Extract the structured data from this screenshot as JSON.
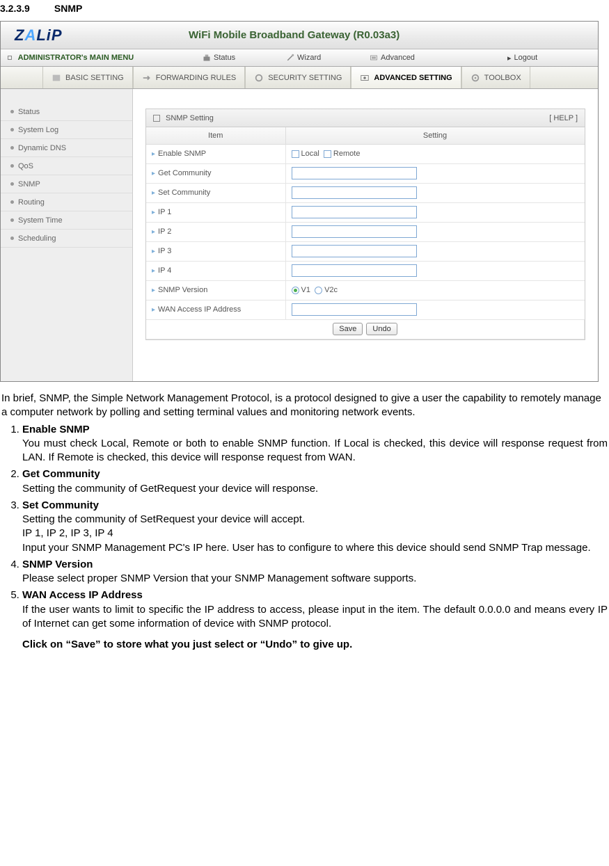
{
  "doc": {
    "section_number": "3.2.3.9",
    "section_title": "SNMP",
    "intro": "In brief, SNMP, the Simple Network Management Protocol, is a protocol designed to give a user the capability to remotely manage a computer network by polling and setting terminal values and monitoring network events.",
    "items": [
      {
        "title": "Enable SNMP",
        "paras": [
          "You must check Local, Remote or both to enable SNMP function. If Local is checked, this device will response request from LAN. If Remote is checked, this device will response request from WAN."
        ]
      },
      {
        "title": "Get Community",
        "paras": [
          "Setting the community of GetRequest your device will response."
        ]
      },
      {
        "title": "Set Community",
        "paras": [
          "Setting the community of SetRequest your device will accept.",
          "IP 1, IP 2, IP 3, IP 4",
          "Input your SNMP Management PC's IP here. User has to configure to where this device should send SNMP Trap message."
        ]
      },
      {
        "title": "SNMP Version",
        "paras": [
          "Please select proper SNMP Version that your SNMP Management software supports."
        ]
      },
      {
        "title": "WAN Access IP Address",
        "paras": [
          "If the user wants to limit to specific the IP address to access, please input in the item. The default 0.0.0.0 and means every IP of Internet can get some information of device with SNMP protocol."
        ]
      }
    ],
    "final": "Click on “Save” to store what you just select or “Undo” to give up."
  },
  "router": {
    "brand": "ZALiP",
    "title": "WiFi Mobile Broadband Gateway (R0.03a3)",
    "topnav": {
      "main": "ADMINISTRATOR's MAIN MENU",
      "status": "Status",
      "wizard": "Wizard",
      "advanced": "Advanced",
      "logout": "Logout"
    },
    "tabs": {
      "basic": "BASIC SETTING",
      "forwarding": "FORWARDING RULES",
      "security": "SECURITY SETTING",
      "advanced": "ADVANCED SETTING",
      "toolbox": "TOOLBOX"
    },
    "sidebar": [
      "Status",
      "System Log",
      "Dynamic DNS",
      "QoS",
      "SNMP",
      "Routing",
      "System Time",
      "Scheduling"
    ],
    "panel": {
      "title": "SNMP Setting",
      "help": "[ HELP ]",
      "col_item": "Item",
      "col_setting": "Setting",
      "rows": {
        "enable": "Enable SNMP",
        "enable_local": "Local",
        "enable_remote": "Remote",
        "get": "Get Community",
        "set": "Set Community",
        "ip1": "IP 1",
        "ip2": "IP 2",
        "ip3": "IP 3",
        "ip4": "IP 4",
        "ver": "SNMP Version",
        "v1": "V1",
        "v2c": "V2c",
        "wan": "WAN Access IP Address"
      },
      "save": "Save",
      "undo": "Undo"
    }
  }
}
